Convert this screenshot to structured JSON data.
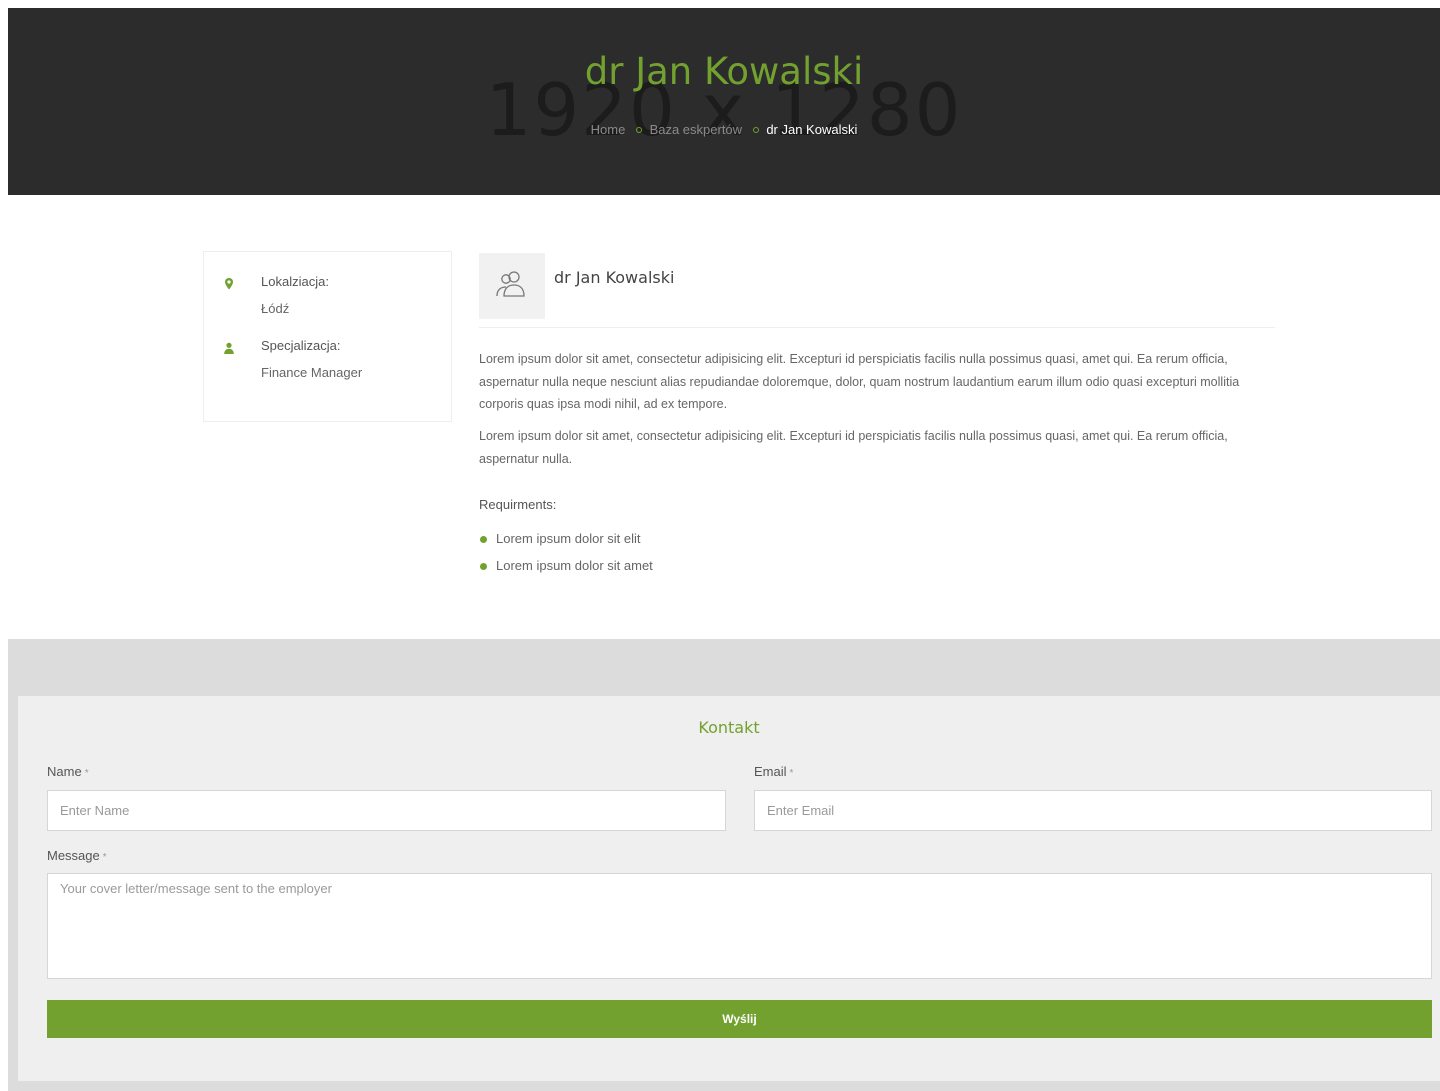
{
  "hero": {
    "watermark": "1920 x 1280",
    "title": "dr Jan Kowalski",
    "breadcrumb": {
      "home": "Home",
      "section": "Baza eskpertów",
      "current": "dr Jan Kowalski"
    }
  },
  "sidebar": {
    "location": {
      "icon": "map-marker-icon",
      "label": "Lokalziacja:",
      "value": "Łódź"
    },
    "specialization": {
      "icon": "user-icon",
      "label": "Specjalizacja:",
      "value": "Finance Manager"
    }
  },
  "profile": {
    "avatar_icon": "users-icon",
    "name": "dr Jan Kowalski",
    "paragraphs": [
      "Lorem ipsum dolor sit amet, consectetur adipisicing elit. Excepturi id perspiciatis facilis nulla possimus quasi, amet qui. Ea rerum officia, aspernatur nulla neque nesciunt alias repudiandae doloremque, dolor, quam nostrum laudantium earum illum odio quasi excepturi mollitia corporis quas ipsa modi nihil, ad ex tempore.",
      "Lorem ipsum dolor sit amet, consectetur adipisicing elit. Excepturi id perspiciatis facilis nulla possimus quasi, amet qui. Ea rerum officia, aspernatur nulla."
    ],
    "requirements_title": "Requirments:",
    "requirements": [
      "Lorem ipsum dolor sit elit",
      "Lorem ipsum dolor sit amet"
    ]
  },
  "contact": {
    "title": "Kontakt",
    "name_label": "Name",
    "name_placeholder": "Enter Name",
    "email_label": "Email",
    "email_placeholder": "Enter Email",
    "message_label": "Message",
    "message_placeholder": "Your cover letter/message sent to the employer",
    "required_mark": "*",
    "submit_label": "Wyślij"
  },
  "colors": {
    "accent": "#72a12f",
    "hero_bg": "#2c2c2c",
    "contact_band": "#dcdcdc",
    "contact_card": "#efefef"
  }
}
